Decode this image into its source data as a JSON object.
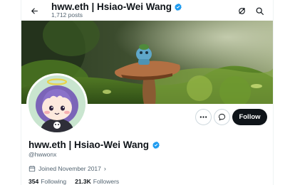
{
  "header": {
    "name": "hww.eth | Hsiao-Wei Wang",
    "posts_count": "1,712 posts"
  },
  "profile": {
    "display_name": "hww.eth | Hsiao-Wei Wang",
    "handle": "@hwwonx",
    "joined": "Joined November 2017",
    "following_count": "354",
    "following_label": "Following",
    "followers_count": "21.3K",
    "followers_label": "Followers"
  },
  "actions": {
    "follow_label": "Follow"
  },
  "icons": {
    "back": "arrow-left-icon",
    "refresh": "refresh-icon",
    "search": "search-icon",
    "more": "more-dots-icon",
    "message": "message-bubble-icon",
    "verified": "verified-badge-icon",
    "calendar": "calendar-icon"
  },
  "colors": {
    "verified_blue": "#1d9bf0",
    "text_primary": "#0f1419",
    "text_secondary": "#536471",
    "follow_button_bg": "#0f1419"
  }
}
